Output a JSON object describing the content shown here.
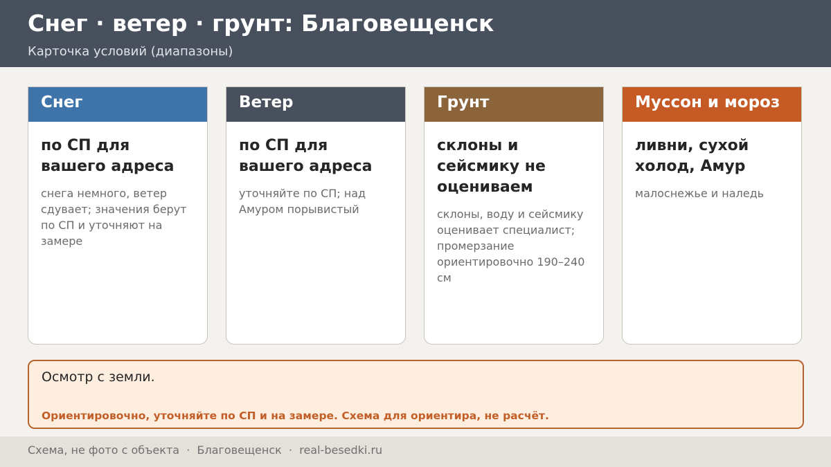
{
  "header": {
    "title": "Снег · ветер · грунт: Благовещенск",
    "subtitle": "Карточка условий (диапазоны)"
  },
  "cards": [
    {
      "heading": "Снег",
      "main": "по СП для вашего адреса",
      "note": "снега немного, ветер сдувает; значения берут по СП и уточняют на замере",
      "color": "#3e74aa"
    },
    {
      "heading": "Ветер",
      "main": "по СП для вашего адреса",
      "note": "уточняйте по СП; над Амуром порывистый",
      "color": "#47505c"
    },
    {
      "heading": "Грунт",
      "main": "склоны и сейсмику не оцениваем",
      "note": "склоны, воду и сейсмику оценивает специалист; промерзание ориентировочно 190–240 см",
      "color": "#8b643c"
    },
    {
      "heading": "Муссон и мороз",
      "main": "ливни, сухой холод, Амур",
      "note": "малоснежье и наледь",
      "color": "#c65a25"
    }
  ],
  "notice": {
    "text": "Осмотр с земли.",
    "warning": "Ориентировочно, уточняйте по СП и на замере. Схема для ориентира, не расчёт."
  },
  "footer": {
    "text": "Схема, не фото с объекта  ·  Благовещенск  ·  real-besedki.ru"
  }
}
